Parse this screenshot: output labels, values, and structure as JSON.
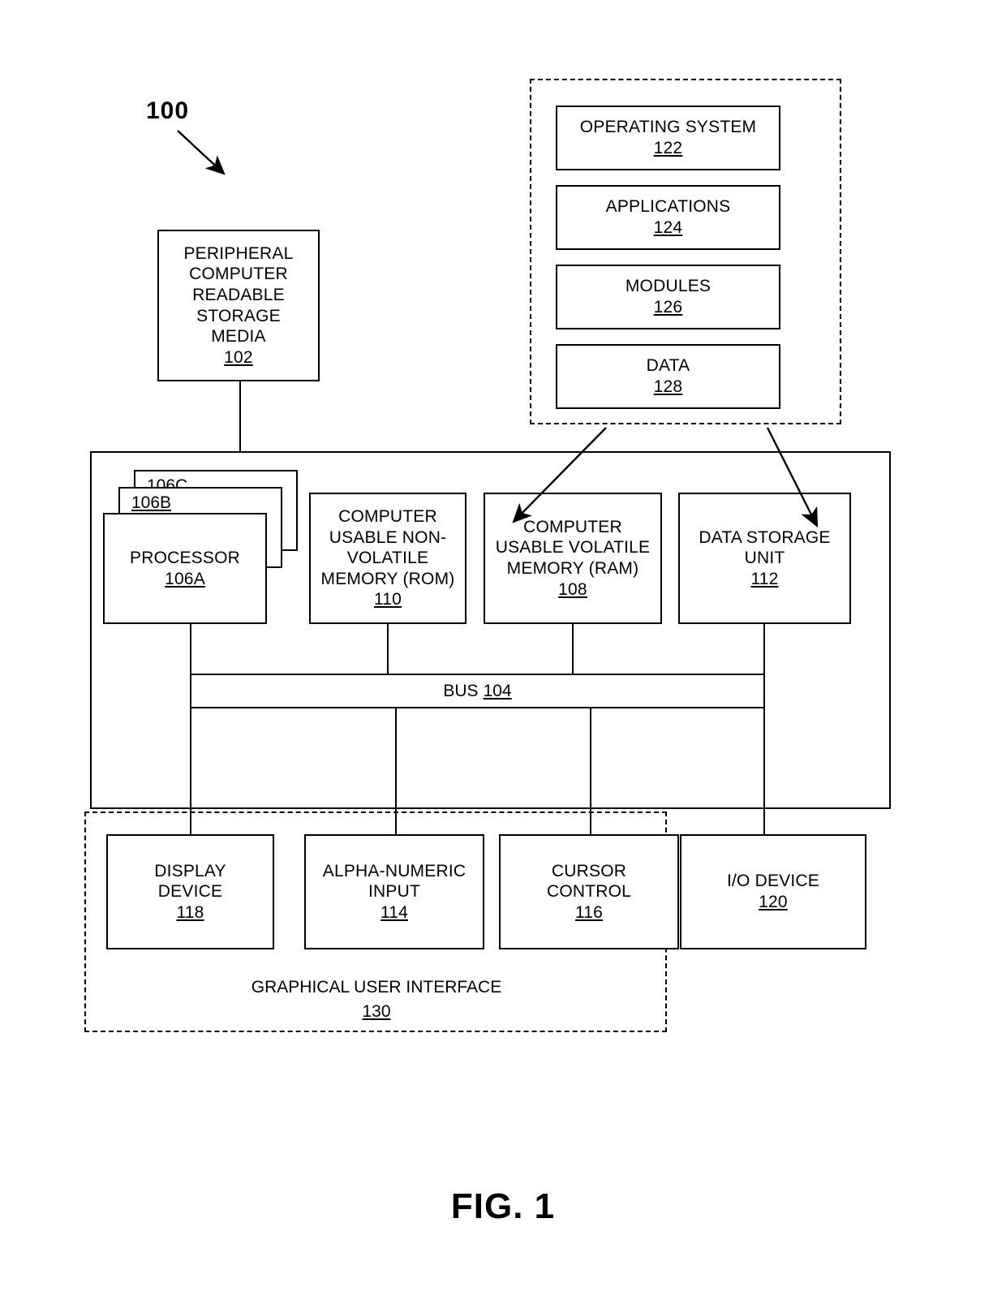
{
  "figure": {
    "caption": "FIG. 1",
    "system_ref": "100"
  },
  "peripheral": {
    "lines": [
      "PERIPHERAL",
      "COMPUTER",
      "READABLE",
      "STORAGE",
      "MEDIA"
    ],
    "number": "102"
  },
  "software_container": {
    "boxes": [
      {
        "label": "OPERATING SYSTEM",
        "number": "122"
      },
      {
        "label": "APPLICATIONS",
        "number": "124"
      },
      {
        "label": "MODULES",
        "number": "126"
      },
      {
        "label": "DATA",
        "number": "128"
      }
    ]
  },
  "processor_stack": {
    "back_label": "106C",
    "middle_label": "106B",
    "front_label": "PROCESSOR",
    "front_number": "106A"
  },
  "memory_row": [
    {
      "name": "rom",
      "lines": [
        "COMPUTER",
        "USABLE NON-",
        "VOLATILE",
        "MEMORY (ROM)"
      ],
      "number": "110"
    },
    {
      "name": "ram",
      "lines": [
        "COMPUTER",
        "USABLE VOLATILE",
        "MEMORY (RAM)"
      ],
      "number": "108"
    },
    {
      "name": "data-storage",
      "lines": [
        "DATA STORAGE",
        "UNIT"
      ],
      "number": "112"
    }
  ],
  "bus": {
    "label": "BUS",
    "number": "104"
  },
  "io_row": [
    {
      "name": "display-device",
      "lines": [
        "DISPLAY",
        "DEVICE"
      ],
      "number": "118"
    },
    {
      "name": "alpha-numeric-input",
      "lines": [
        "ALPHA-NUMERIC",
        "INPUT"
      ],
      "number": "114"
    },
    {
      "name": "cursor-control",
      "lines": [
        "CURSOR",
        "CONTROL"
      ],
      "number": "116"
    },
    {
      "name": "io-device",
      "lines": [
        "I/O DEVICE"
      ],
      "number": "120"
    }
  ],
  "gui": {
    "label": "GRAPHICAL USER INTERFACE",
    "number": "130"
  },
  "colors": {
    "line": "#000000",
    "background": "#ffffff"
  }
}
